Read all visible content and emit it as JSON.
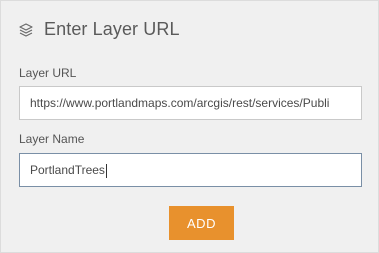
{
  "header": {
    "icon": "layers-icon",
    "title": "Enter Layer URL"
  },
  "form": {
    "url_label": "Layer URL",
    "url_value": "https://www.portlandmaps.com/arcgis/rest/services/Publi",
    "name_label": "Layer Name",
    "name_value": "PortlandTrees"
  },
  "actions": {
    "add_label": "ADD"
  },
  "colors": {
    "background": "#f0f0f0",
    "accent": "#e8912d",
    "focus_border": "#7a8fa6"
  }
}
